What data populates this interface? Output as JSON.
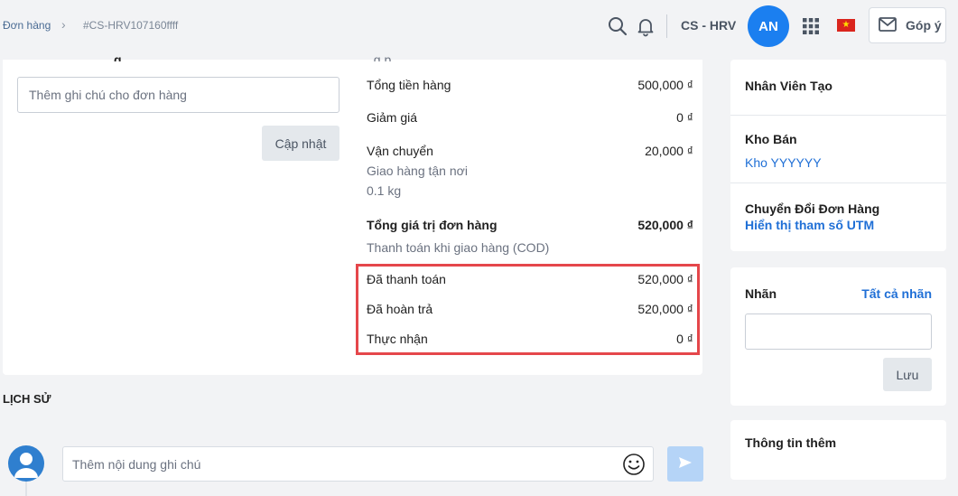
{
  "breadcrumb": {
    "home": "Đơn hàng",
    "separator": "›",
    "code": "#CS-HRV107160ffff"
  },
  "header": {
    "icons": [
      "search-icon",
      "bell-icon",
      "apps-grid-icon",
      "vietnam-flag-icon",
      "mail-icon"
    ],
    "shop_name": "CS - HRV",
    "avatar_initials": "AN",
    "feedback_label": "Góp ý",
    "accent_color": "#1b7ff0"
  },
  "order_note": {
    "partial_heading": "g",
    "placeholder": "Thêm ghi chú cho đơn hàng",
    "update_label": "Cập nhật"
  },
  "summary": {
    "partial_heading": ", g    p",
    "subtotal": {
      "label": "Tổng tiền hàng",
      "value": "500,000 ₫"
    },
    "discount": {
      "label": "Giảm giá",
      "value": "0 ₫"
    },
    "shipping": {
      "label": "Vận chuyển",
      "value": "20,000 ₫",
      "method": "Giao hàng tận nơi",
      "weight": "0.1 kg"
    },
    "total": {
      "label": "Tổng giá trị đơn hàng",
      "value": "520,000 ₫"
    },
    "payment_method": "Thanh toán khi giao hàng (COD)",
    "paid": {
      "label": "Đã thanh toán",
      "value": "520,000 ₫"
    },
    "refunded": {
      "label": "Đã hoàn trả",
      "value": "520,000 ₫"
    },
    "net_received": {
      "label": "Thực nhận",
      "value": "0 ₫"
    },
    "highlight_color": "#e5474b"
  },
  "history": {
    "title": "LỊCH SỬ",
    "comment_placeholder": "Thêm nội dung ghi chú",
    "send_icon": "send-icon",
    "emoji_icon": "smile-icon"
  },
  "sidebar": {
    "creator_title": "Nhân Viên Tạo",
    "warehouse_title": "Kho Bán",
    "warehouse_value": "Kho YYYYYY",
    "conversion_title": "Chuyển Đổi Đơn Hàng",
    "conversion_link": "Hiển thị tham số UTM",
    "tags_title": "Nhãn",
    "tags_all_link": "Tất cả nhãn",
    "tags_save_label": "Lưu",
    "more_info_title": "Thông tin thêm",
    "link_color": "#1f6fd6"
  }
}
